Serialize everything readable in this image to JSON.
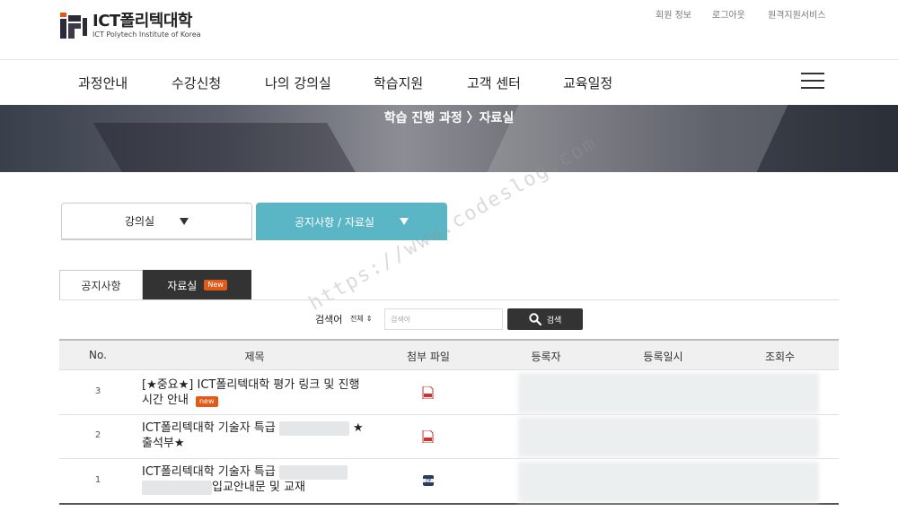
{
  "header": {
    "logo_title": "ICT폴리텍대학",
    "logo_subtitle": "ICT Polytech Institute of Korea",
    "util_links": [
      "회원 정보",
      "로그아웃",
      "원격지원서비스"
    ]
  },
  "nav": {
    "items": [
      "과정안내",
      "수강신청",
      "나의 강의실",
      "학습지원",
      "고객 센터",
      "교육일정"
    ]
  },
  "banner": {
    "breadcrumb": "학습 진행 과정 〉자료실"
  },
  "selectors": {
    "course": "강의실",
    "notice": "공지사항 / 자료실"
  },
  "tabs": {
    "notice": "공지사항",
    "data": "자료실",
    "data_badge": "New"
  },
  "search": {
    "label": "검색어",
    "select_value": "전체",
    "placeholder": "검색어",
    "button": "검색"
  },
  "table": {
    "headers": [
      "No.",
      "제목",
      "첨부 파일",
      "등록자",
      "등록일시",
      "조회수"
    ],
    "rows": [
      {
        "no": "3",
        "title_line1": "[★중요★] ICT폴리텍대학 평가 링크 및 진행",
        "title_line2": "시간 안내",
        "badge": "new",
        "file": "pdf-icon"
      },
      {
        "no": "2",
        "title_line1": "ICT폴리텍대학 기술자 특급",
        "title_line1_suffix": "★",
        "title_line2": "출석부★",
        "file": "pdf-icon"
      },
      {
        "no": "1",
        "title_line1": "ICT폴리텍대학 기술자 특급",
        "title_line2_suffix": "입교안내문 및 교재",
        "file": "zip-icon"
      }
    ]
  },
  "watermark": "https://www.codeslog.com",
  "colors": {
    "accent": "#5ab5c5",
    "dark": "#333333",
    "badge": "#e05a1a"
  }
}
